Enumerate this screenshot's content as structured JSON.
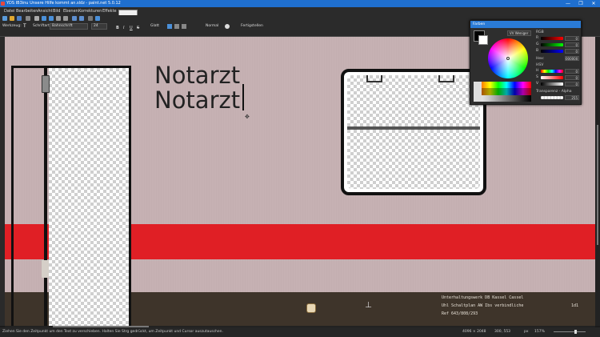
{
  "window": {
    "title": "YDS IB3inu Unsere Hilfe kommt an.sldz - paint.net 5.0.12",
    "controls": [
      "—",
      "❐",
      "✕"
    ]
  },
  "menu": {
    "items": [
      "Datei",
      "Bearbeiten",
      "Ansicht",
      "Bild",
      "Ebenen",
      "Korrekturen",
      "Effekte"
    ]
  },
  "toolbar": {
    "tool_label": "Werkzeug:",
    "font_label": "Schriftart",
    "font_value": "Bahnschrift",
    "size_value": "24",
    "antialias_label": "Glatt",
    "blend_label": "Normal",
    "finish_label": "Fertigstellen"
  },
  "canvas": {
    "text_lines": [
      "Notarzt",
      "Notarzt"
    ],
    "footer_lines": [
      "Unterhaltungswerk DB Kassel Cassel",
      "Uhl Schaltplan    AW Ibs   verbindliche",
      "Ref  643/808/293"
    ],
    "footer_number": "1d1",
    "colors": {
      "wall": "#c6b1b3",
      "stripe": "#e01f25",
      "floor": "#3e342a"
    }
  },
  "palette": {
    "title": "Farben",
    "dropdown": "VV Weniger",
    "rgb_label": "RGB",
    "r_label": "R",
    "g_label": "G",
    "b_label": "B",
    "r_value": "0",
    "g_value": "0",
    "b_value": "0",
    "hex_label": "Hex:",
    "hex_value": "000000",
    "hsv_label": "HSV",
    "h_label": "H",
    "s_label": "S",
    "v_label": "V",
    "h_value": "0",
    "s_value": "0",
    "v_value": "0",
    "alpha_label": "Transparenz - Alpha",
    "alpha_value": "255"
  },
  "status": {
    "hint": "Ziehen Sie den Zeitpunkt um den Text zu verschieben. Halten Sie Strg gedrückt, um Zeitpunkt und Cursor auszutauschen.",
    "image_size": "4096 × 2048",
    "cursor_pos": "300, 553",
    "unit": "px",
    "zoom": "157%"
  }
}
